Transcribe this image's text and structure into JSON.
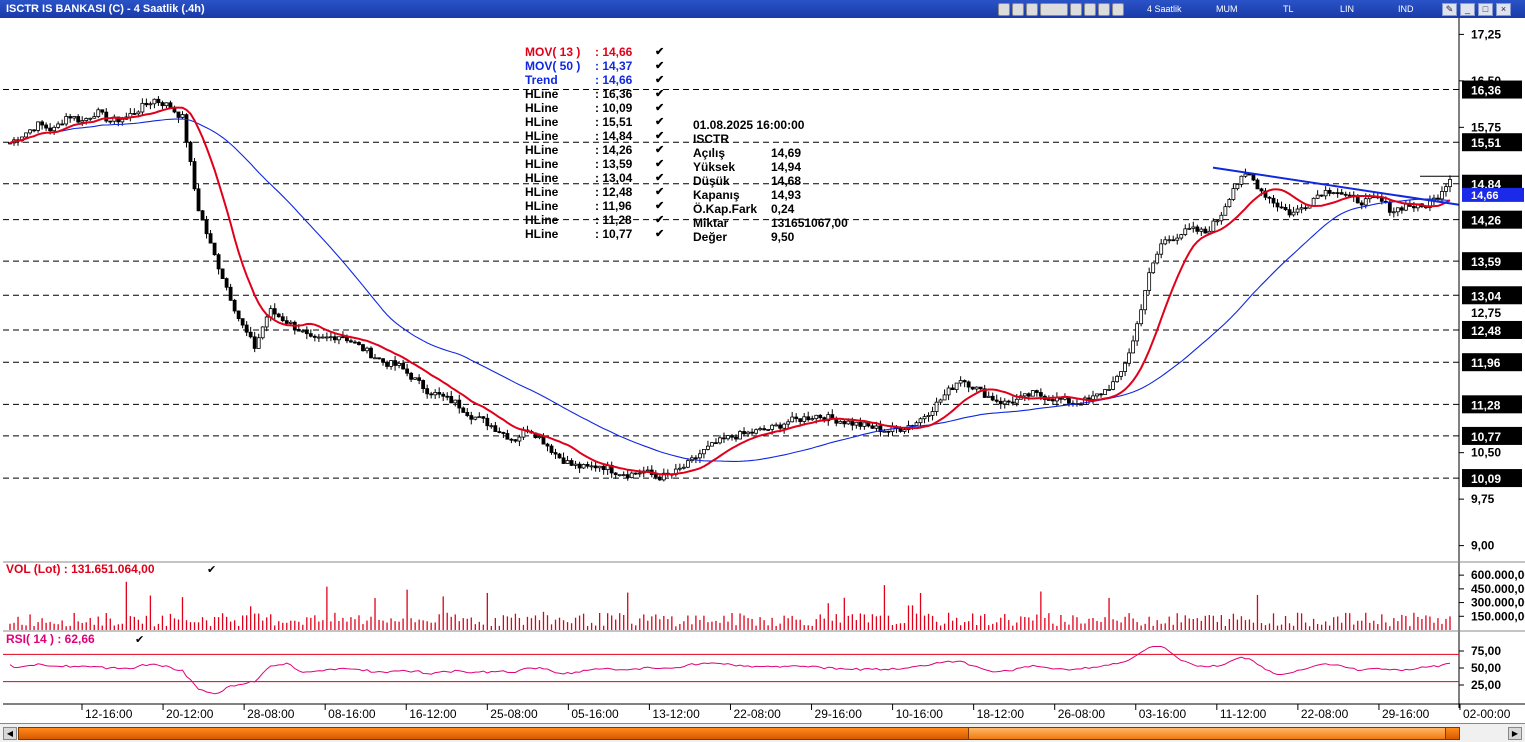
{
  "window": {
    "title": "ISCTR IS BANKASI (C) - 4 Saatlik (.4h)",
    "toolbar_words": [
      "4 Saatlik",
      "MUM",
      "TL",
      "LIN",
      "IND"
    ]
  },
  "colors": {
    "mov13": "#e0001a",
    "mov50": "#1028e0",
    "trend": "#1028e0",
    "vol": "#e0001a",
    "rsi": "#e0007a",
    "titlebar": "#1a3aa8",
    "price_badge": "#1a2ae8"
  },
  "legend": [
    {
      "name": "MOV( 13 )",
      "value": ": 14,66",
      "color": "#e0001a"
    },
    {
      "name": "MOV( 50 )",
      "value": ": 14,37",
      "color": "#1028e0"
    },
    {
      "name": "Trend",
      "value": ": 14,66",
      "color": "#1028e0"
    },
    {
      "name": "HLine",
      "value": ": 16,36",
      "color": "#000000"
    },
    {
      "name": "HLine",
      "value": ": 10,09",
      "color": "#000000"
    },
    {
      "name": "HLine",
      "value": ": 15,51",
      "color": "#000000"
    },
    {
      "name": "HLine",
      "value": ": 14,84",
      "color": "#000000"
    },
    {
      "name": "HLine",
      "value": ": 14,26",
      "color": "#000000"
    },
    {
      "name": "HLine",
      "value": ": 13,59",
      "color": "#000000"
    },
    {
      "name": "HLine",
      "value": ": 13,04",
      "color": "#000000"
    },
    {
      "name": "HLine",
      "value": ": 12,48",
      "color": "#000000"
    },
    {
      "name": "HLine",
      "value": ": 11,96",
      "color": "#000000"
    },
    {
      "name": "HLine",
      "value": ": 11,28",
      "color": "#000000"
    },
    {
      "name": "HLine",
      "value": ": 10,77",
      "color": "#000000"
    }
  ],
  "info_box": {
    "datetime": "01.08.2025   16:00:00",
    "symbol": "ISCTR",
    "rows": [
      {
        "label": "Açılış",
        "value": "14,69"
      },
      {
        "label": "Yüksek",
        "value": "14,94"
      },
      {
        "label": "Düşük",
        "value": "14,68"
      },
      {
        "label": "Kapanış",
        "value": "14,93"
      },
      {
        "label": "Ö.Kap.Fark",
        "value": "0,24"
      },
      {
        "label": "Miktar",
        "value": "131651067,00"
      },
      {
        "label": "Değer",
        "value": "9,50"
      }
    ]
  },
  "volume_label": "VOL (Lot)  : 131.651.064,00",
  "rsi_label": "RSI( 14 )   : 62,66",
  "chart_data": {
    "type": "candlestick",
    "symbol": "ISCTR",
    "timeframe": "4 Saatlik",
    "price_axis": {
      "min": 8.8,
      "max": 17.45,
      "ticks": [
        "17,25",
        "16,50",
        "15,75",
        "10,50",
        "9,75",
        "9,00"
      ]
    },
    "hlines": [
      16.36,
      15.51,
      14.84,
      14.26,
      13.59,
      13.04,
      12.48,
      11.96,
      11.28,
      10.77,
      10.09
    ],
    "hline_labels": [
      "16,36",
      "15,51",
      "14,84",
      "14,26",
      "13,59",
      "13,04",
      "12,48",
      "11,96",
      "11,28",
      "10,77",
      "10,09"
    ],
    "extra_price_labels": [
      "12,75"
    ],
    "current_price_label": "14,66",
    "x_tick_labels": [
      "12-16:00",
      "20-12:00",
      "28-08:00",
      "08-16:00",
      "16-12:00",
      "25-08:00",
      "05-16:00",
      "13-12:00",
      "22-08:00",
      "29-16:00",
      "10-16:00",
      "18-12:00",
      "26-08:00",
      "03-16:00",
      "11-12:00",
      "22-08:00",
      "29-16:00",
      "02-00:00"
    ],
    "close_path": [
      15.5,
      15.65,
      15.8,
      15.7,
      15.95,
      15.85,
      16.0,
      15.85,
      15.9,
      16.05,
      16.2,
      16.1,
      15.9,
      14.5,
      13.8,
      13.2,
      12.6,
      12.2,
      12.8,
      12.65,
      12.5,
      12.3,
      12.35,
      12.4,
      12.25,
      12.1,
      11.95,
      11.9,
      11.7,
      11.5,
      11.4,
      11.3,
      11.1,
      11.0,
      10.85,
      10.7,
      10.9,
      10.7,
      10.45,
      10.3,
      10.25,
      10.3,
      10.2,
      10.15,
      10.2,
      10.1,
      10.15,
      10.3,
      10.5,
      10.65,
      10.75,
      10.8,
      10.85,
      10.9,
      11.0,
      11.05,
      11.1,
      11.05,
      11.0,
      10.95,
      10.9,
      10.85,
      10.9,
      11.0,
      11.2,
      11.45,
      11.7,
      11.55,
      11.4,
      11.3,
      11.35,
      11.45,
      11.4,
      11.35,
      11.3,
      11.35,
      11.5,
      11.7,
      12.3,
      13.3,
      13.9,
      14.0,
      14.1,
      14.05,
      14.3,
      14.8,
      15.0,
      14.7,
      14.5,
      14.35,
      14.5,
      14.7,
      14.75,
      14.6,
      14.55,
      14.6,
      14.4,
      14.5,
      14.45,
      14.6,
      14.93
    ],
    "volume_axis": {
      "ticks": [
        "600.000,00",
        "450.000,00",
        "300.000,00",
        "150.000,00"
      ]
    },
    "rsi_axis": {
      "ticks": [
        "75,00",
        "50,00",
        "25,00"
      ],
      "upper": 70,
      "lower": 30
    },
    "rsi_value": 62.66,
    "volume_value": 131651064
  }
}
